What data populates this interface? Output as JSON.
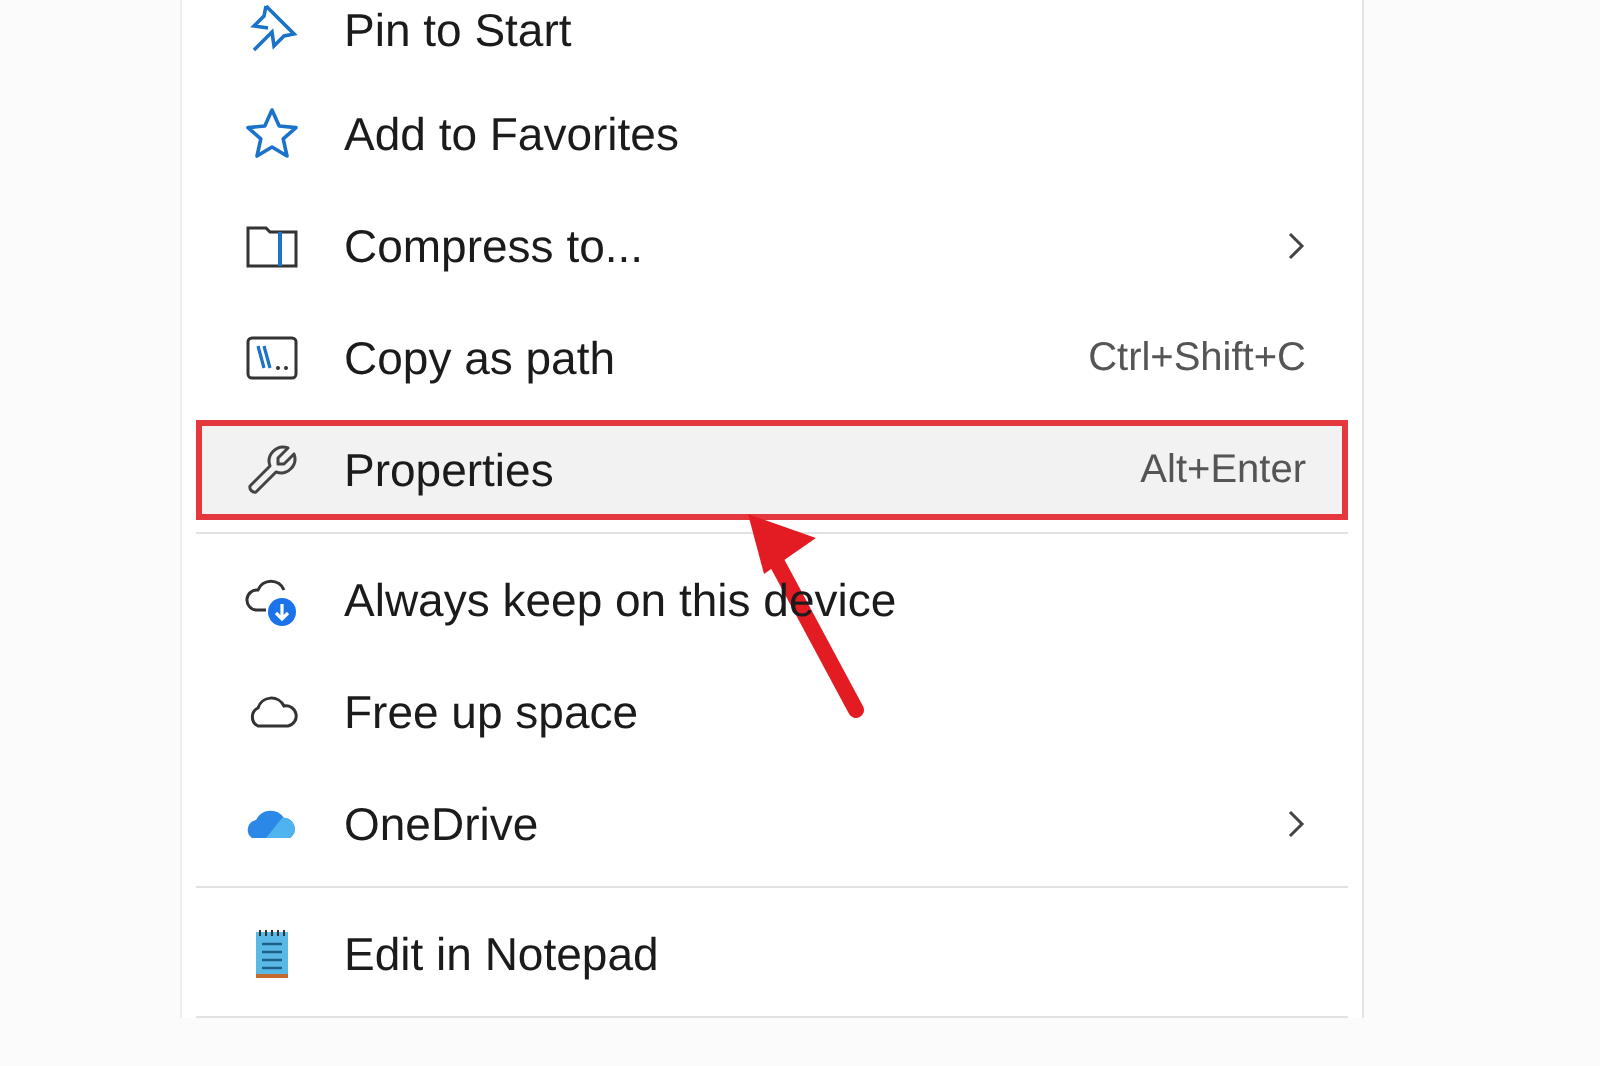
{
  "menu": {
    "groups": [
      {
        "items": [
          {
            "label": "Pin to Start",
            "submenu": false,
            "selected": false
          },
          {
            "label": "Add to Favorites",
            "submenu": false,
            "selected": false
          },
          {
            "label": "Compress to...",
            "submenu": true,
            "selected": false
          },
          {
            "label": "Copy as path",
            "shortcut": "Ctrl+Shift+C",
            "submenu": false,
            "selected": false
          },
          {
            "label": "Properties",
            "shortcut": "Alt+Enter",
            "submenu": false,
            "selected": true
          }
        ]
      },
      {
        "items": [
          {
            "label": "Always keep on this device",
            "submenu": false,
            "selected": false
          },
          {
            "label": "Free up space",
            "submenu": false,
            "selected": false
          },
          {
            "label": "OneDrive",
            "submenu": true,
            "selected": false
          }
        ]
      },
      {
        "items": [
          {
            "label": "Edit in Notepad",
            "submenu": false,
            "selected": false
          }
        ]
      }
    ]
  }
}
